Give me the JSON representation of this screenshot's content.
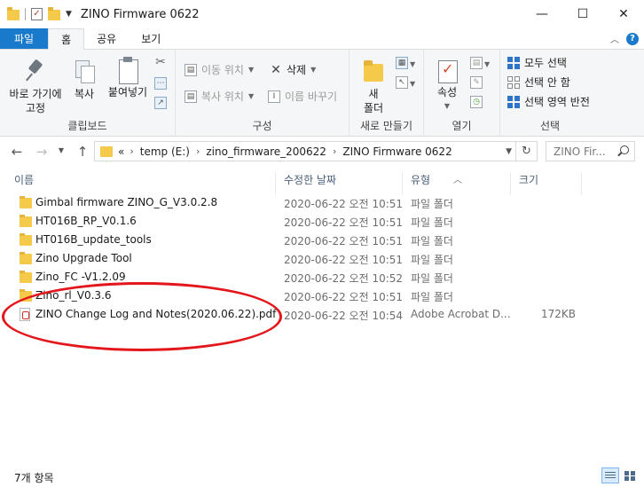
{
  "window": {
    "title": "ZINO Firmware 0622",
    "controls": {
      "minimize": "—",
      "maximize": "☐",
      "close": "✕"
    }
  },
  "ribbon_tabs": [
    {
      "label": "파일"
    },
    {
      "label": "홈"
    },
    {
      "label": "공유"
    },
    {
      "label": "보기"
    }
  ],
  "ribbon": {
    "clipboard": {
      "pin": "바로 가기에",
      "pin2": "고정",
      "copy": "복사",
      "paste": "붙여넣기",
      "group": "클립보드"
    },
    "organize": {
      "move_to": "이동 위치",
      "copy_to": "복사 위치",
      "delete": "삭제",
      "rename": "이름 바꾸기",
      "group": "구성"
    },
    "new": {
      "new_folder": "새",
      "new_folder2": "폴더",
      "group": "새로 만들기"
    },
    "open": {
      "properties": "속성",
      "group": "열기"
    },
    "select": {
      "select_all": "모두 선택",
      "select_none": "선택 안 함",
      "invert": "선택 영역 반전",
      "group": "선택"
    }
  },
  "address": {
    "overflow": "«",
    "crumbs": [
      "temp (E:)",
      "zino_firmware_200622",
      "ZINO Firmware 0622"
    ],
    "search_placeholder": "ZINO Fir..."
  },
  "columns": {
    "name": "이름",
    "date": "수정한 날짜",
    "type": "유형",
    "size": "크기"
  },
  "files": [
    {
      "name": "Gimbal firmware ZINO_G_V3.0.2.8",
      "date": "2020-06-22 오전 10:51",
      "type": "파일 폴더",
      "size": "",
      "kind": "folder"
    },
    {
      "name": "HT016B_RP_V0.1.6",
      "date": "2020-06-22 오전 10:51",
      "type": "파일 폴더",
      "size": "",
      "kind": "folder"
    },
    {
      "name": "HT016B_update_tools",
      "date": "2020-06-22 오전 10:51",
      "type": "파일 폴더",
      "size": "",
      "kind": "folder"
    },
    {
      "name": "Zino Upgrade Tool",
      "date": "2020-06-22 오전 10:51",
      "type": "파일 폴더",
      "size": "",
      "kind": "folder"
    },
    {
      "name": "Zino_FC -V1.2.09",
      "date": "2020-06-22 오전 10:52",
      "type": "파일 폴더",
      "size": "",
      "kind": "folder"
    },
    {
      "name": "Zino_rl_V0.3.6",
      "date": "2020-06-22 오전 10:51",
      "type": "파일 폴더",
      "size": "",
      "kind": "folder"
    },
    {
      "name": "ZINO Change Log and Notes(2020.06.22).pdf",
      "date": "2020-06-22 오전 10:54",
      "type": "Adobe Acrobat D...",
      "size": "172KB",
      "kind": "pdf"
    }
  ],
  "status": {
    "item_count": "7개 항목"
  },
  "colors": {
    "accent": "#1979ca",
    "annotation": "#e3161b",
    "folder": "#f5c94a"
  }
}
